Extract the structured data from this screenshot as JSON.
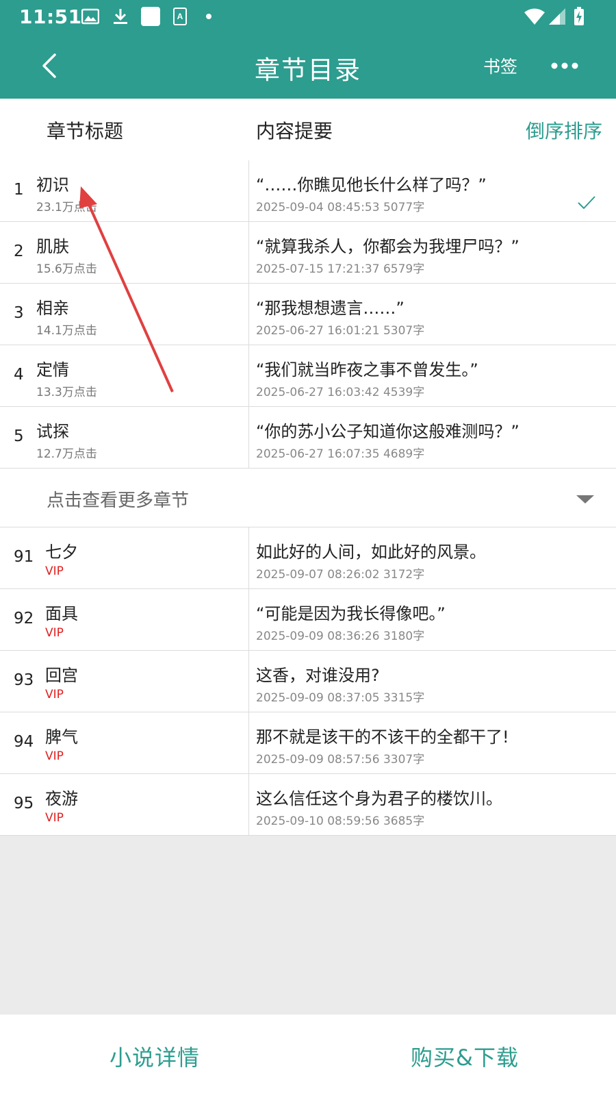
{
  "status": {
    "time": "11:51",
    "icons": [
      "image-icon",
      "download-icon",
      "square-icon",
      "text-icon",
      "dot-icon",
      "wifi-icon",
      "signal-icon",
      "battery-charging-icon"
    ]
  },
  "appbar": {
    "title": "章节目录",
    "bookmark": "书签",
    "icons": [
      "back-icon",
      "more-icon"
    ]
  },
  "header": {
    "chapter_title": "章节标题",
    "summary": "内容提要",
    "sort": "倒序排序"
  },
  "chapters_top": [
    {
      "num": "1",
      "title": "初识",
      "sub": "23.1万点击",
      "summary": "“……你瞧见他长什么样了吗？”",
      "meta": "2025-09-04 08:45:53  5077字",
      "checked": true
    },
    {
      "num": "2",
      "title": "肌肤",
      "sub": "15.6万点击",
      "summary": "“就算我杀人，你都会为我埋尸吗？”",
      "meta": "2025-07-15 17:21:37  6579字"
    },
    {
      "num": "3",
      "title": "相亲",
      "sub": "14.1万点击",
      "summary": "“那我想想遗言……”",
      "meta": "2025-06-27 16:01:21  5307字"
    },
    {
      "num": "4",
      "title": "定情",
      "sub": "13.3万点击",
      "summary": "“我们就当昨夜之事不曾发生。”",
      "meta": "2025-06-27 16:03:42  4539字"
    },
    {
      "num": "5",
      "title": "试探",
      "sub": "12.7万点击",
      "summary": "“你的苏小公子知道你这般难测吗？”",
      "meta": "2025-06-27 16:07:35  4689字"
    }
  ],
  "more_chapters": "点击查看更多章节",
  "chapters_bottom": [
    {
      "num": "91",
      "title": "七夕",
      "sub": "VIP",
      "summary": "如此好的人间，如此好的风景。",
      "meta": "2025-09-07 08:26:02  3172字"
    },
    {
      "num": "92",
      "title": "面具",
      "sub": "VIP",
      "summary": "“可能是因为我长得像吧。”",
      "meta": "2025-09-09 08:36:26  3180字"
    },
    {
      "num": "93",
      "title": "回宫",
      "sub": "VIP",
      "summary": "这香，对谁没用?",
      "meta": "2025-09-09 08:37:05  3315字"
    },
    {
      "num": "94",
      "title": "脾气",
      "sub": "VIP",
      "summary": "那不就是该干的不该干的全都干了!",
      "meta": "2025-09-09 08:57:56  3307字"
    },
    {
      "num": "95",
      "title": "夜游",
      "sub": "VIP",
      "summary": "这么信任这个身为君子的楼饮川。",
      "meta": "2025-09-10 08:59:56  3685字"
    }
  ],
  "bottombar": {
    "details": "小说详情",
    "buy_download": "购买&下载"
  },
  "colors": {
    "accent": "#2c9d8f",
    "vip": "#e02020",
    "annotation_arrow": "#e04040"
  }
}
